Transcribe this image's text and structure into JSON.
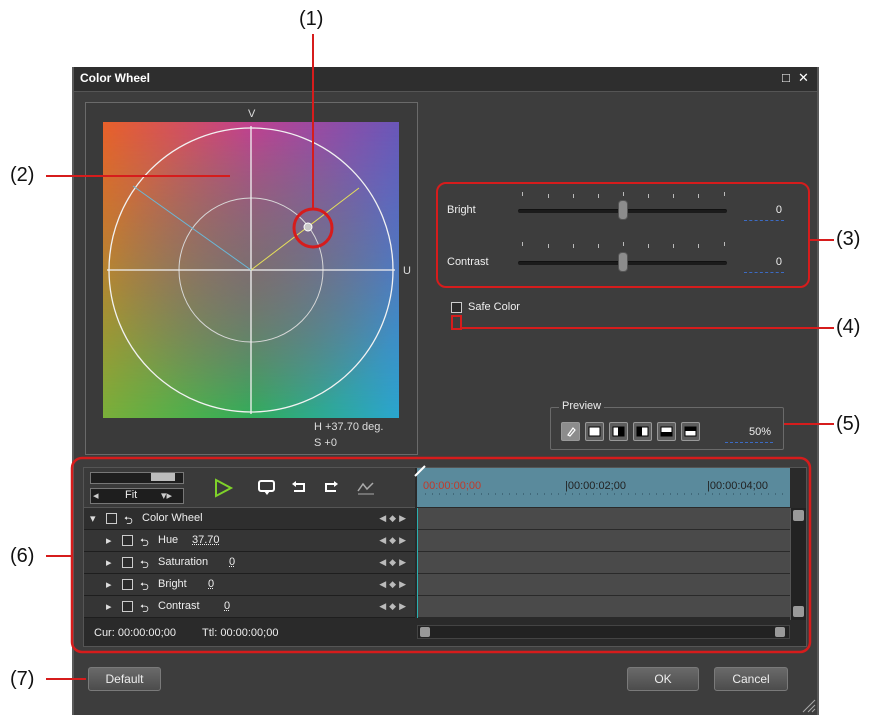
{
  "callouts": [
    "(1)",
    "(2)",
    "(3)",
    "(4)",
    "(5)",
    "(6)",
    "(7)"
  ],
  "dialog": {
    "title": "Color Wheel",
    "maximize_glyph": "□",
    "close_glyph": "✕"
  },
  "wheel": {
    "v_label": "V",
    "u_label": "U",
    "hue_readout": "H  +37.70 deg.",
    "sat_readout": "S   +0"
  },
  "sliders": {
    "bright": {
      "label": "Bright",
      "value": "0",
      "level": 0.5
    },
    "contrast": {
      "label": "Contrast",
      "value": "0",
      "level": 0.5
    }
  },
  "safe_color": {
    "label": "Safe Color",
    "checked": false
  },
  "preview": {
    "label": "Preview",
    "zoom": "50%"
  },
  "timeline": {
    "fit_label": "Fit",
    "ruler": [
      "00:00:00;00",
      "|00:00:02;00",
      "|00:00:04;00"
    ],
    "tracks": [
      {
        "label": "Color Wheel",
        "value": ""
      },
      {
        "label": "Hue",
        "value": "37.70"
      },
      {
        "label": "Saturation",
        "value": "0"
      },
      {
        "label": "Bright",
        "value": "0"
      },
      {
        "label": "Contrast",
        "value": "0"
      }
    ],
    "cur": "Cur: 00:00:00;00",
    "ttl": "Ttl: 00:00:00;00"
  },
  "buttons": {
    "default": "Default",
    "ok": "OK",
    "cancel": "Cancel"
  },
  "colors": {
    "callout_red": "#d61c1c",
    "dialog_bg": "#3d3d3d",
    "track_bg": "#2a2a2a",
    "accent_blue": "#3c6bc4"
  }
}
